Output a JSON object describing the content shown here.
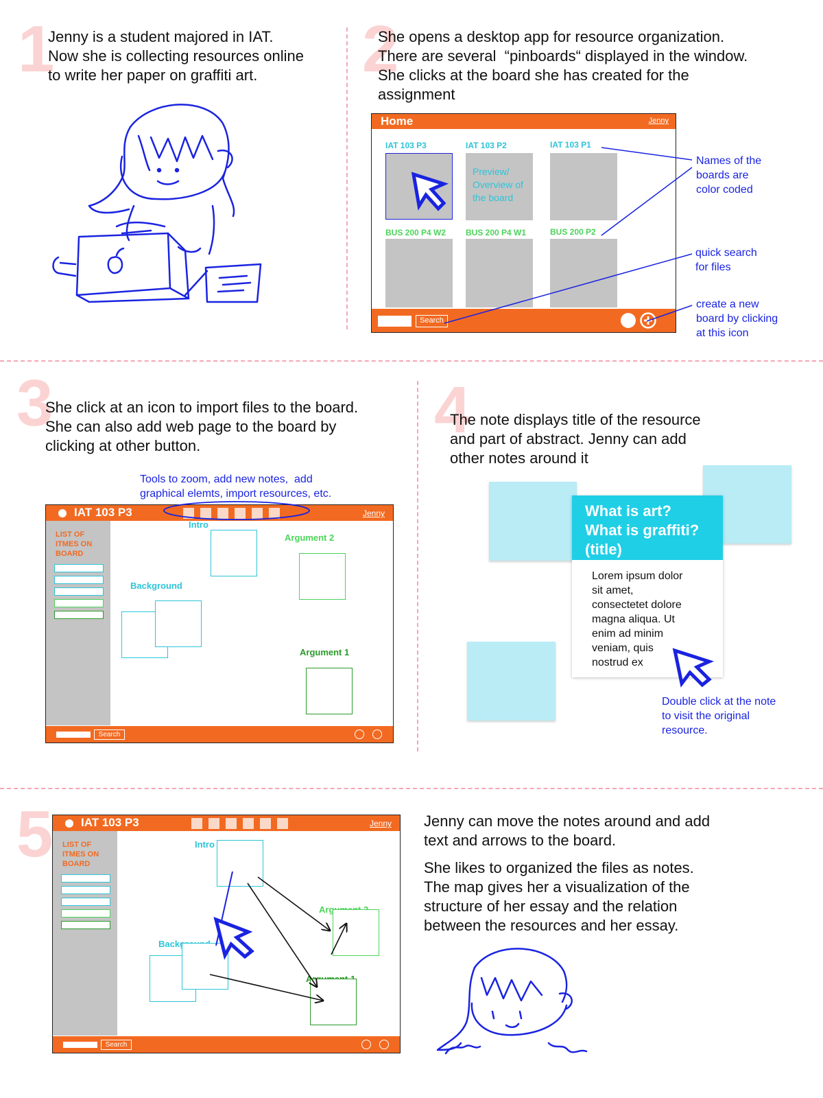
{
  "colors": {
    "accent": "#f26a21",
    "annotation": "#1a23e0",
    "cyan": "#2cc4d8",
    "green": "#4cd35a",
    "dark_green": "#2a9a2a",
    "sticky": "#b9ecf5",
    "note_header": "#1fcfe6",
    "divider": "#f3a6b8",
    "number": "#fbd3d3"
  },
  "panel1": {
    "number": "1",
    "lines": [
      "Jenny is a student majored in IAT.",
      "Now she is collecting resources online",
      "to write her paper on graffiti art."
    ]
  },
  "panel2": {
    "number": "2",
    "lines": [
      "She opens a desktop app for resource organization.",
      "There are several  “pinboards“ displayed in the window.",
      "She clicks at the board she has created for the",
      "assignment"
    ],
    "app": {
      "title": "Home",
      "user": "Jenny",
      "boards": [
        {
          "label": "IAT 103 P3"
        },
        {
          "label": "IAT 103 P2",
          "preview_text": [
            "Preview/",
            "Overview of",
            "the board"
          ]
        },
        {
          "label": "IAT 103 P1"
        },
        {
          "label": "BUS 200 P4 W2"
        },
        {
          "label": "BUS 200 P4 W1"
        },
        {
          "label": "BUS 200 P2"
        }
      ],
      "search_label": "Search",
      "icons": [
        "dot-icon",
        "plus-circle-icon"
      ]
    },
    "annotations": {
      "names": [
        "Names of the",
        "boards are",
        "color coded"
      ],
      "search": [
        "quick search",
        "for files"
      ],
      "create": [
        "create a new",
        "board by clicking",
        "at this icon"
      ]
    }
  },
  "panel3": {
    "number": "3",
    "lines": [
      "She click at an icon to import files to the board.",
      "She can also add web page to the board by",
      "clicking at other button."
    ],
    "tools_annotation": [
      "Tools to zoom, add new notes,  add",
      "graphical elemts, import resources, etc."
    ],
    "app": {
      "title": "IAT 103 P3",
      "user": "Jenny",
      "side_title": [
        "LIST OF",
        "ITMES ON",
        "BOARD"
      ],
      "search_label": "Search",
      "notes": {
        "intro": "Intro",
        "argument2": "Argument 2",
        "background": "Background",
        "argument1": "Argument 1"
      }
    }
  },
  "panel4": {
    "number": "4",
    "lines": [
      "The note displays title of the resource",
      "and part of abstract. Jenny can add",
      "other notes around it"
    ],
    "note_title": [
      "What is art?",
      "What is graffiti?",
      "(title)"
    ],
    "note_body": [
      "Lorem ipsum dolor",
      "sit amet,",
      "consectetet dolore",
      "magna aliqua. Ut",
      "enim ad minim",
      "veniam, quis",
      "nostrud ex"
    ],
    "annotation": [
      "Double click at the note",
      "to visit the original",
      "resource."
    ]
  },
  "panel5": {
    "number": "5",
    "lines1": [
      "Jenny can move the notes around and add",
      "text and arrows to the board."
    ],
    "lines2": [
      "She likes to organized the files as notes.",
      "The map gives her a visualization of the",
      "structure of her essay and the relation",
      "between the resources and her essay."
    ],
    "app": {
      "title": "IAT 103 P3",
      "user": "Jenny",
      "side_title": [
        "LIST OF",
        "ITMES ON",
        "BOARD"
      ],
      "search_label": "Search",
      "notes": {
        "intro": "Intro",
        "argument2": "Argument 2",
        "background": "Background",
        "argument1": "Argument 1"
      }
    }
  }
}
